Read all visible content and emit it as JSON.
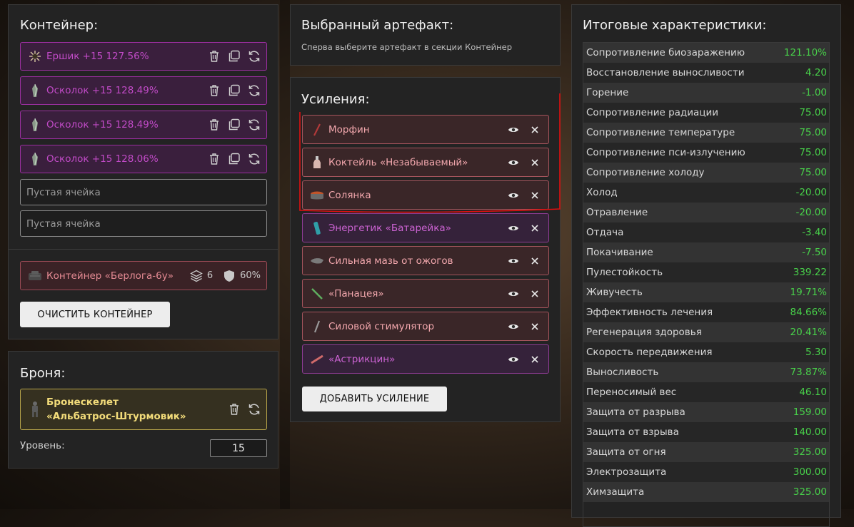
{
  "container_panel": {
    "title": "Контейнер:",
    "artifacts": [
      {
        "label": "Ершик +15 127.56%",
        "icon": "sea-urchin-icon"
      },
      {
        "label": "Осколок +15 128.49%",
        "icon": "shard-icon"
      },
      {
        "label": "Осколок +15 128.49%",
        "icon": "shard-icon"
      },
      {
        "label": "Осколок +15 128.06%",
        "icon": "shard-icon"
      }
    ],
    "empty_slots": [
      "Пустая ячейка",
      "Пустая ячейка"
    ],
    "container": {
      "label": "Контейнер «Берлога-6у»",
      "slots": "6",
      "protection": "60%"
    },
    "clear_button": "ОЧИСТИТЬ КОНТЕЙНЕР"
  },
  "armor_panel": {
    "title": "Броня:",
    "armor_label": "Бронескелет «Альбатрос-Штурмовик»",
    "level_label": "Уровень:",
    "level_value": "15"
  },
  "selected_panel": {
    "title": "Выбранный артефакт:",
    "hint": "Сперва выберите артефакт в секции Контейнер"
  },
  "boosts_panel": {
    "title": "Усиления:",
    "items": [
      {
        "label": "Морфин",
        "style": "red"
      },
      {
        "label": "Коктейль «Незабываемый»",
        "style": "red"
      },
      {
        "label": "Солянка",
        "style": "red"
      },
      {
        "label": "Энергетик «Батарейка»",
        "style": "purple"
      },
      {
        "label": "Сильная мазь от ожогов",
        "style": "red"
      },
      {
        "label": "«Панацея»",
        "style": "red"
      },
      {
        "label": "Силовой стимулятор",
        "style": "red"
      },
      {
        "label": "«Астрикцин»",
        "style": "purple"
      }
    ],
    "add_button": "ДОБАВИТЬ УСИЛЕНИЕ"
  },
  "stats_panel": {
    "title": "Итоговые характеристики:",
    "stats": [
      {
        "name": "Сопротивление биозаражению",
        "value": "121.10%"
      },
      {
        "name": "Восстановление выносливости",
        "value": "4.20"
      },
      {
        "name": "Горение",
        "value": "-1.00"
      },
      {
        "name": "Сопротивление радиации",
        "value": "75.00"
      },
      {
        "name": "Сопротивление температуре",
        "value": "75.00"
      },
      {
        "name": "Сопротивление пси-излучению",
        "value": "75.00"
      },
      {
        "name": "Сопротивление холоду",
        "value": "75.00"
      },
      {
        "name": "Холод",
        "value": "-20.00"
      },
      {
        "name": "Отравление",
        "value": "-20.00"
      },
      {
        "name": "Отдача",
        "value": "-3.40"
      },
      {
        "name": "Покачивание",
        "value": "-7.50"
      },
      {
        "name": "Пулестойкость",
        "value": "339.22"
      },
      {
        "name": "Живучесть",
        "value": "19.71%"
      },
      {
        "name": "Эффективность лечения",
        "value": "84.66%"
      },
      {
        "name": "Регенерация здоровья",
        "value": "20.41%"
      },
      {
        "name": "Скорость передвижения",
        "value": "5.30"
      },
      {
        "name": "Выносливость",
        "value": "73.87%"
      },
      {
        "name": "Переносимый вес",
        "value": "46.10"
      },
      {
        "name": "Защита от разрыва",
        "value": "159.00"
      },
      {
        "name": "Защита от взрыва",
        "value": "140.00"
      },
      {
        "name": "Защита от огня",
        "value": "325.00"
      },
      {
        "name": "Электрозащита",
        "value": "300.00"
      },
      {
        "name": "Химзащита",
        "value": "325.00"
      }
    ]
  },
  "colors": {
    "accent_artifact": "#c24bc8",
    "accent_stat": "#48d04a",
    "highlight_annotation": "#e01010"
  }
}
